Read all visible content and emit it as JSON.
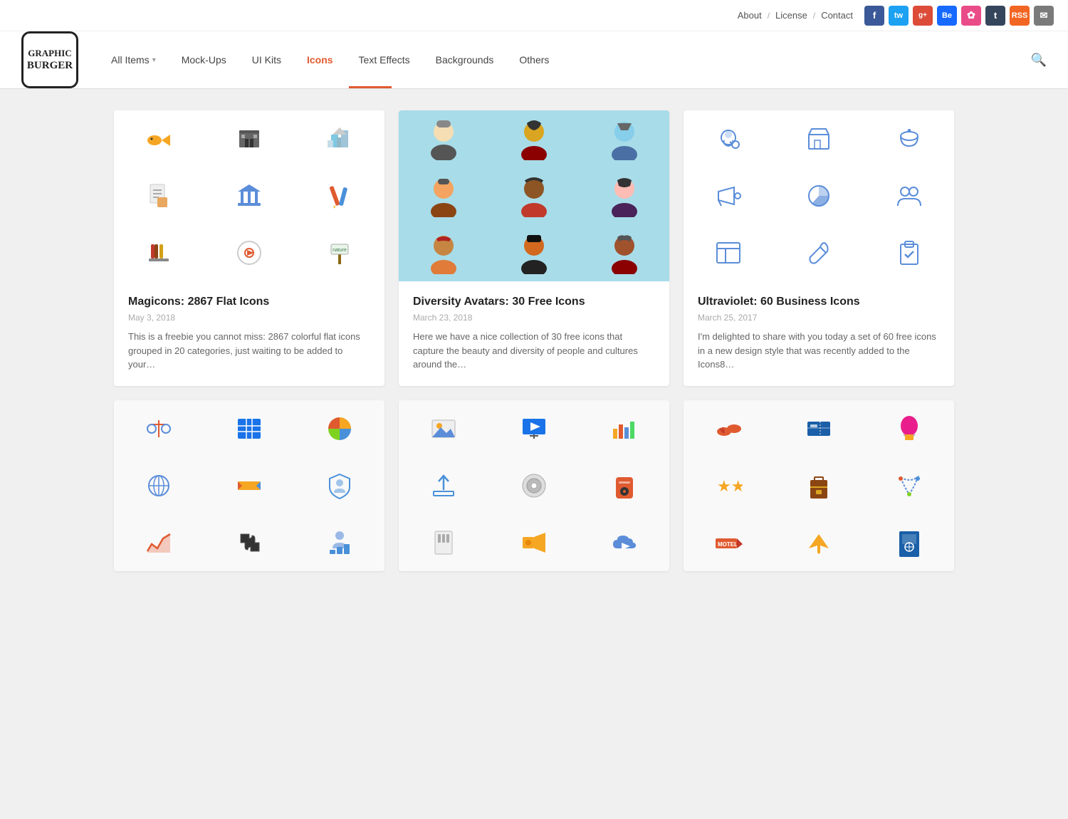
{
  "topbar": {
    "links": [
      "About",
      "License",
      "Contact"
    ],
    "separators": [
      "/",
      "/"
    ],
    "social": [
      {
        "name": "facebook",
        "label": "f",
        "class": "si-fb"
      },
      {
        "name": "twitter",
        "label": "t",
        "class": "si-tw"
      },
      {
        "name": "googleplus",
        "label": "g+",
        "class": "si-gp"
      },
      {
        "name": "behance",
        "label": "Be",
        "class": "si-be"
      },
      {
        "name": "dribbble",
        "label": "◕",
        "class": "si-dr"
      },
      {
        "name": "tumblr",
        "label": "t",
        "class": "si-tm"
      },
      {
        "name": "rss",
        "label": "▶",
        "class": "si-rss"
      },
      {
        "name": "email",
        "label": "✉",
        "class": "si-em"
      }
    ]
  },
  "logo": {
    "line1": "GRAPHIC",
    "line2": "BURGER"
  },
  "nav": {
    "items": [
      {
        "label": "All Items",
        "id": "all-items",
        "active": false,
        "hasArrow": true
      },
      {
        "label": "Mock-Ups",
        "id": "mock-ups",
        "active": false,
        "hasArrow": false
      },
      {
        "label": "UI Kits",
        "id": "ui-kits",
        "active": false,
        "hasArrow": false
      },
      {
        "label": "Icons",
        "id": "icons",
        "active": true,
        "hasArrow": false
      },
      {
        "label": "Text Effects",
        "id": "text-effects",
        "active": false,
        "hasArrow": false
      },
      {
        "label": "Backgrounds",
        "id": "backgrounds",
        "active": false,
        "hasArrow": false
      },
      {
        "label": "Others",
        "id": "others",
        "active": false,
        "hasArrow": false
      }
    ]
  },
  "cards": [
    {
      "id": "magicons",
      "title": "Magicons: 2867 Flat Icons",
      "date": "May 3, 2018",
      "description": "This is a freebie you cannot miss: 2867 colorful flat icons grouped in 20 categories, just waiting to be added to your…",
      "bg": "white"
    },
    {
      "id": "diversity",
      "title": "Diversity Avatars: 30 Free Icons",
      "date": "March 23, 2018",
      "description": "Here we have a nice collection of 30 free icons that capture the beauty and diversity of people and cultures around the…",
      "bg": "teal"
    },
    {
      "id": "ultraviolet",
      "title": "Ultraviolet: 60 Business Icons",
      "date": "March 25, 2017",
      "description": "I'm delighted to share with you today a set of 60 free icons in a new design style that was recently added to the Icons8…",
      "bg": "white"
    }
  ],
  "bottom_cards": [
    {
      "id": "infographic",
      "bg": "white"
    },
    {
      "id": "media",
      "bg": "white"
    },
    {
      "id": "travel",
      "bg": "white"
    }
  ]
}
